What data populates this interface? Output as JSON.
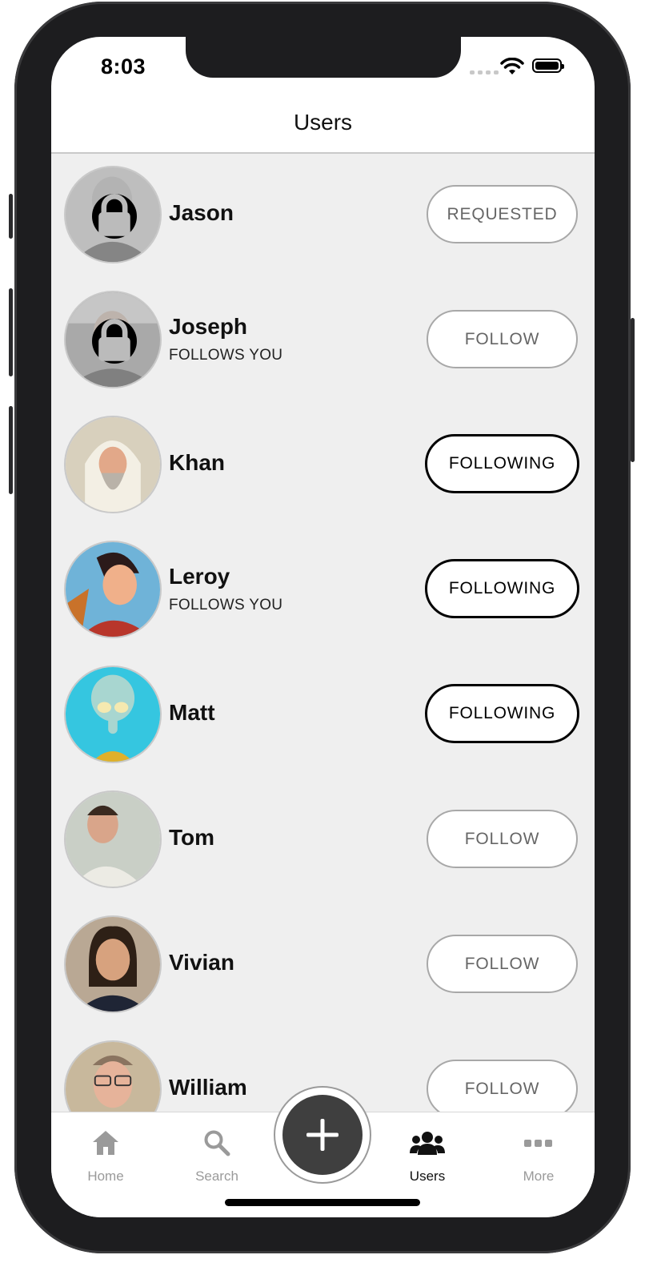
{
  "status_bar": {
    "time": "8:03"
  },
  "header": {
    "title": "Users"
  },
  "users": [
    {
      "name": "Jason",
      "subtitle": "",
      "button": "REQUESTED",
      "button_style": "outline",
      "private": true
    },
    {
      "name": "Joseph",
      "subtitle": "FOLLOWS YOU",
      "button": "FOLLOW",
      "button_style": "outline",
      "private": true
    },
    {
      "name": "Khan",
      "subtitle": "",
      "button": "FOLLOWING",
      "button_style": "bold",
      "private": false
    },
    {
      "name": "Leroy",
      "subtitle": "FOLLOWS YOU",
      "button": "FOLLOWING",
      "button_style": "bold",
      "private": false
    },
    {
      "name": "Matt",
      "subtitle": "",
      "button": "FOLLOWING",
      "button_style": "bold",
      "private": false
    },
    {
      "name": "Tom",
      "subtitle": "",
      "button": "FOLLOW",
      "button_style": "outline",
      "private": false
    },
    {
      "name": "Vivian",
      "subtitle": "",
      "button": "FOLLOW",
      "button_style": "outline",
      "private": false
    },
    {
      "name": "William",
      "subtitle": "",
      "button": "FOLLOW",
      "button_style": "outline",
      "private": false
    }
  ],
  "tabbar": {
    "home": "Home",
    "search": "Search",
    "users": "Users",
    "more": "More",
    "active": "Users"
  },
  "colors": {
    "list_bg": "#efefef",
    "accent": "#000000",
    "inactive_tab": "#9a9a9a",
    "fab": "#3f3f3f"
  }
}
